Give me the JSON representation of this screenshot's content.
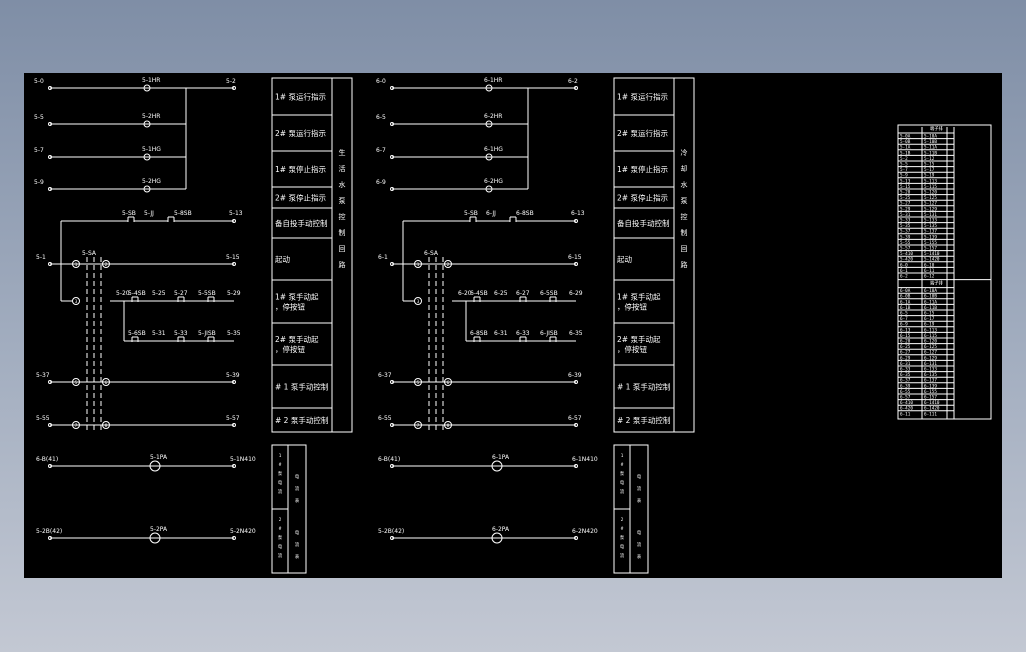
{
  "colors": {
    "sheet": "#000000",
    "line": "#ffffff",
    "backdrop_top": "#7f8ea6",
    "backdrop_bottom": "#c3c8d3"
  },
  "sections": [
    {
      "id": "s5",
      "wires": [
        {
          "left": "5-0",
          "mid": "5-1HR",
          "right": "5-2"
        },
        {
          "left": "5-5",
          "mid": "5-2HR",
          "right": ""
        },
        {
          "left": "5-7",
          "mid": "5-1HG",
          "right": ""
        },
        {
          "left": "5-9",
          "mid": "5-2HG",
          "right": ""
        }
      ],
      "row13": {
        "sa": "5-SB",
        "sb": "5-JJ",
        "sc": "5-8SB",
        "right": "5-13"
      },
      "sa_label": "5-SA",
      "row_start": {
        "left": "5-1",
        "right": "5-15"
      },
      "manual_row1": {
        "a": "5-20",
        "b": "5-4SB",
        "c": "5-25",
        "d": "5-27",
        "e": "5-5SB",
        "f": "5-29"
      },
      "manual_row2": {
        "b": "5-6SB",
        "c": "5-31",
        "d": "5-33",
        "e": "5-JISB",
        "f": "5-35"
      },
      "row37": {
        "left": "5-37",
        "right": "5-39"
      },
      "row55": {
        "left": "5-55",
        "right": "5-57"
      },
      "meter1": {
        "left": "6-B(41)",
        "mid": "5-1PA",
        "right": "5-1N410"
      },
      "meter2": {
        "left": "5-2B(42)",
        "mid": "5-2PA",
        "right": "5-2N420"
      }
    },
    {
      "id": "s6",
      "wires": [
        {
          "left": "6-0",
          "mid": "6-1HR",
          "right": "6-2"
        },
        {
          "left": "6-5",
          "mid": "6-2HR",
          "right": ""
        },
        {
          "left": "6-7",
          "mid": "6-1HG",
          "right": ""
        },
        {
          "left": "6-9",
          "mid": "6-2HG",
          "right": ""
        }
      ],
      "row13": {
        "sa": "5-SB",
        "sb": "6-JJ",
        "sc": "6-8SB",
        "right": "6-13"
      },
      "sa_label": "6-SA",
      "row_start": {
        "left": "6-1",
        "right": "6-15"
      },
      "manual_row1": {
        "a": "6-20",
        "b": "6-4SB",
        "c": "6-25",
        "d": "6-27",
        "e": "6-5SB",
        "f": "6-29"
      },
      "manual_row2": {
        "b": "6-8SB",
        "c": "6-31",
        "d": "6-33",
        "e": "6-JISB",
        "f": "6-35"
      },
      "row37": {
        "left": "6-37",
        "right": "6-39"
      },
      "row55": {
        "left": "6-55",
        "right": "6-57"
      },
      "meter1": {
        "left": "6-B(41)",
        "mid": "6-1PA",
        "right": "6-1N410"
      },
      "meter2": {
        "left": "5-2B(42)",
        "mid": "6-2PA",
        "right": "6-2N420"
      }
    }
  ],
  "node_nums": [
    "1",
    "2",
    "3",
    "4",
    "5",
    "6",
    "7",
    "8"
  ],
  "legend_rows": [
    "1# 泵运行指示",
    "2# 泵运行指示",
    "1# 泵停止指示",
    "2# 泵停止指示",
    "备自投手动控制",
    "起动",
    "1# 泵手动起，停按钮",
    "2# 泵手动起，停按钮",
    "# 1 泵手动控制",
    "# 2 泵手动控制"
  ],
  "legend_side": [
    "s5",
    "s6"
  ],
  "legend_vertical": {
    "s5": "生 活 水 泵 控 制 回 路",
    "s6": "冷 却 水 泵 控 制 回 路"
  },
  "meter_legend": [
    {
      "left": "1 # 泵 电 流",
      "right": "电 流 表"
    },
    {
      "left": "2 # 泵 电 流",
      "right": "电 流 表"
    }
  ],
  "table": {
    "header1": "端子排",
    "header2": "端子排",
    "rows_a": [
      "5-0A",
      "5-0B",
      "5-1A",
      "5-1B",
      "5-2",
      "5-5",
      "5-7",
      "5-9",
      "5-13",
      "5-15",
      "5-20",
      "5-25",
      "5-27",
      "5-29",
      "5-31",
      "5-33",
      "5-35",
      "5-37",
      "5-39",
      "5-55",
      "5-57",
      "5-410",
      "5-420",
      "6-0",
      "6-1",
      "6-2"
    ],
    "rows_b": [
      "6-0A",
      "6-0B",
      "6-1A",
      "6-1B",
      "6-5",
      "6-7",
      "6-9",
      "6-13",
      "6-15",
      "6-20",
      "6-25",
      "6-27",
      "6-29",
      "6-31",
      "6-33",
      "6-35",
      "6-37",
      "6-39",
      "6-55",
      "6-57",
      "6-410",
      "6-420",
      "6-11",
      "6-12"
    ]
  }
}
